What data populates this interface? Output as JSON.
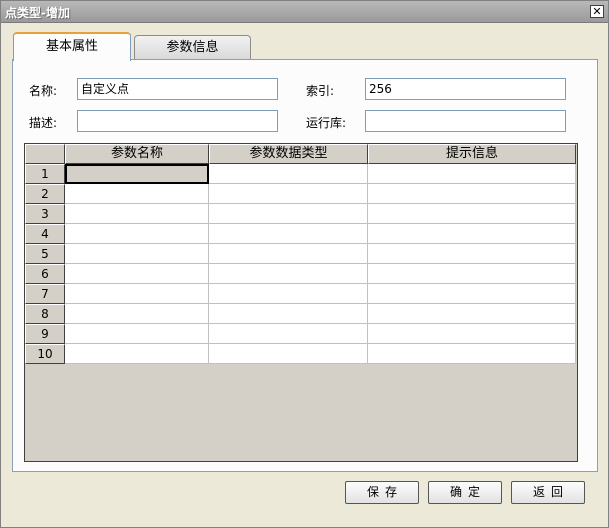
{
  "window": {
    "title": "点类型-增加",
    "close_glyph": "✕"
  },
  "tabs": [
    {
      "label": "基本属性",
      "active": true
    },
    {
      "label": "参数信息",
      "active": false
    }
  ],
  "form": {
    "name_label": "名称:",
    "name_value": "自定义点",
    "index_label": "索引:",
    "index_value": "256",
    "desc_label": "描述:",
    "desc_value": "",
    "runtime_label": "运行库:",
    "runtime_value": ""
  },
  "grid": {
    "columns": [
      "参数名称",
      "参数数据类型",
      "提示信息"
    ],
    "rows": [
      {
        "num": "1",
        "cells": [
          "",
          "",
          ""
        ]
      },
      {
        "num": "2",
        "cells": [
          "",
          "",
          ""
        ]
      },
      {
        "num": "3",
        "cells": [
          "",
          "",
          ""
        ]
      },
      {
        "num": "4",
        "cells": [
          "",
          "",
          ""
        ]
      },
      {
        "num": "5",
        "cells": [
          "",
          "",
          ""
        ]
      },
      {
        "num": "6",
        "cells": [
          "",
          "",
          ""
        ]
      },
      {
        "num": "7",
        "cells": [
          "",
          "",
          ""
        ]
      },
      {
        "num": "8",
        "cells": [
          "",
          "",
          ""
        ]
      },
      {
        "num": "9",
        "cells": [
          "",
          "",
          ""
        ]
      },
      {
        "num": "10",
        "cells": [
          "",
          "",
          ""
        ]
      }
    ],
    "selected_row": 1,
    "selected_col": 1
  },
  "buttons": {
    "save": "保存",
    "ok": "确定",
    "back": "返回"
  }
}
